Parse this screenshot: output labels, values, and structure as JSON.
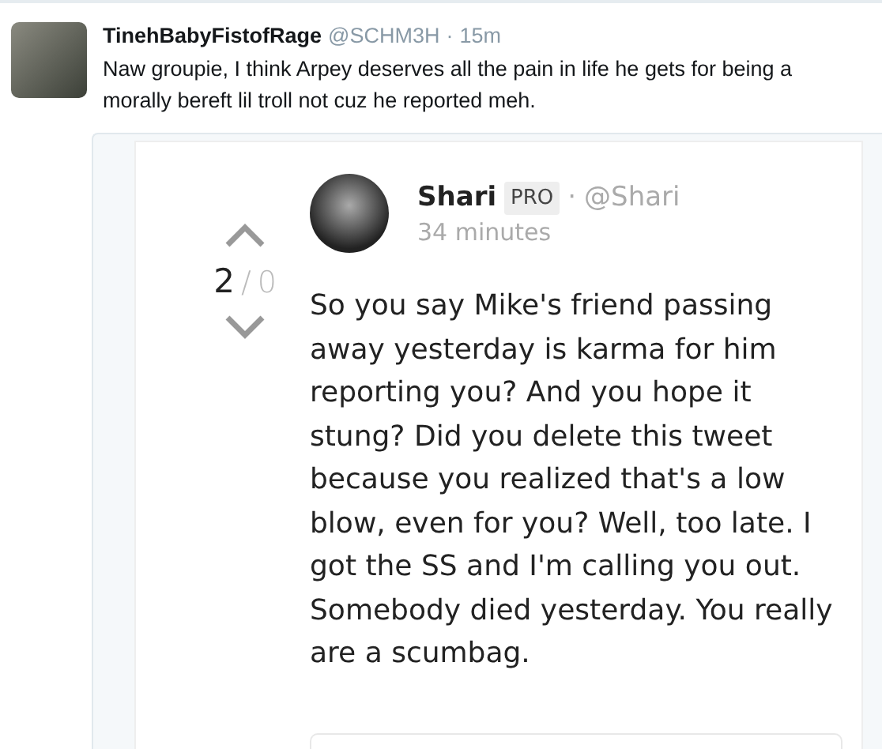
{
  "tweet": {
    "name": "TinehBabyFistofRage",
    "handle": "@SCHM3H",
    "separator": "·",
    "time": "15m",
    "text": "Naw groupie, I think Arpey deserves all the pain in life he gets for being a morally bereft lil troll not cuz he reported meh."
  },
  "embed": {
    "votes": {
      "up": "2",
      "slash": "/",
      "down": "0"
    },
    "author": {
      "name": "Shari",
      "badge": "PRO",
      "separator": "·",
      "handle": "@Shari",
      "time": "34 minutes"
    },
    "text": "So you say Mike's friend passing away yesterday is karma for him reporting you? And you hope it stung? Did you delete this tweet because you realized that's a low blow, even for you? Well, too late. I got the SS and I'm calling you out. Somebody died yesterday. You really are a scumbag."
  }
}
